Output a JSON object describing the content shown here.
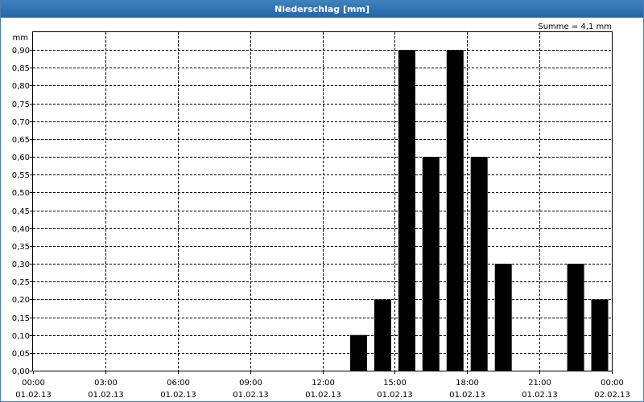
{
  "window": {
    "title": "Niederschlag [mm]"
  },
  "chart_data": {
    "type": "bar",
    "title": "Niederschlag [mm]",
    "ylabel": "mm",
    "annotation": "Summe = 4,1 mm",
    "ylim": [
      0,
      0.95
    ],
    "xlim": [
      "01.02.13 00:00",
      "02.02.13 00:00"
    ],
    "y_ticks": [
      "0,00",
      "0,05",
      "0,10",
      "0,15",
      "0,20",
      "0,25",
      "0,30",
      "0,35",
      "0,40",
      "0,45",
      "0,50",
      "0,55",
      "0,60",
      "0,65",
      "0,70",
      "0,75",
      "0,80",
      "0,85",
      "0,90"
    ],
    "x_ticks": [
      {
        "time": "00:00",
        "date": "01.02.13"
      },
      {
        "time": "03:00",
        "date": "01.02.13"
      },
      {
        "time": "06:00",
        "date": "01.02.13"
      },
      {
        "time": "09:00",
        "date": "01.02.13"
      },
      {
        "time": "12:00",
        "date": "01.02.13"
      },
      {
        "time": "15:00",
        "date": "01.02.13"
      },
      {
        "time": "18:00",
        "date": "01.02.13"
      },
      {
        "time": "21:00",
        "date": "01.02.13"
      },
      {
        "time": "00:00",
        "date": "02.02.13"
      }
    ],
    "grid": true,
    "bar_color": "#000000",
    "series": [
      {
        "x": [
          "01.02.13 13:00",
          "01.02.13 14:00",
          "01.02.13 15:00",
          "01.02.13 16:00",
          "01.02.13 17:00",
          "01.02.13 18:00",
          "01.02.13 19:00",
          "01.02.13 22:00",
          "01.02.13 23:00"
        ],
        "values": [
          0.1,
          0.2,
          0.9,
          0.6,
          0.9,
          0.6,
          0.3,
          0.3,
          0.2
        ]
      }
    ]
  }
}
